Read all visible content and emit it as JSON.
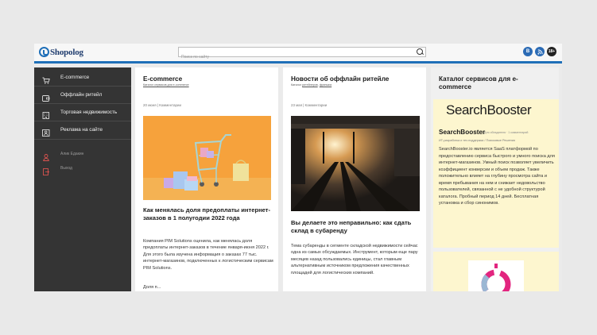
{
  "header": {
    "logo_text": "Shopolog",
    "search_placeholder": "Поиск по сайту",
    "social": [
      "В",
      "ℜ",
      "18+"
    ]
  },
  "sidebar": {
    "items": [
      {
        "label": "E-commerce",
        "icon": "cart-icon"
      },
      {
        "label": "Оффлайн ритейл",
        "icon": "wallet-icon"
      },
      {
        "label": "Торговая недвижимость",
        "icon": "building-icon"
      },
      {
        "label": "Реклама на сайте",
        "icon": "person-card-icon"
      }
    ],
    "user": {
      "name": "Алик Едакин",
      "logout": "Выход"
    }
  },
  "columns": [
    {
      "title": "E-commerce",
      "subtitle": "Каталог сервисов для e-commerce",
      "date": "20 июня",
      "comments": "Комментарии",
      "post_title": "Как менялась доля предоплаты интернет-заказов в 1 полугодии 2022 года",
      "post_text": "Компания PIM Solutions оценила, как менялась доля предоплаты интернет-заказов в течение января-июня 2022 г. Для этого была изучена информация о заказах 77 тыс. интернет-магазинов, подключенных к логистическим сервисам PIM Solutions.",
      "post_more": "Доля п..."
    },
    {
      "title": "Новости об оффлайн ритейле",
      "subtitle_prefix": "Каталог",
      "subtitle_links": [
        "ритейлеров",
        "франшиз"
      ],
      "date": "23 мая",
      "comments": "Комментарии",
      "post_title": "Вы делаете это неправильно: как сдать склад в субаренду",
      "post_text": "Тема субаренды в сегменте складской недвижимости сейчас одна из самых обсуждаемых. Инструмент, которым еще пару месяцев назад пользовались единицы, стал главным альтернативным источником предложения качественных площадей для логистических компаний."
    },
    {
      "title": "Каталог сервисов для e-commerce",
      "featured": {
        "logo": "SearchBooster",
        "name": "SearchBooster",
        "tags": "Для обладателя · 1 комментарий",
        "category": "ИТ-разработка и тех.поддержка / Поисковые Решения",
        "description": "SearchBooster.io является SaaS платформой по предоставлению сервиса быстрого и умного поиска для интернет-магазинов. Умный поиск позволяет увеличить коэффициент конверсии и объем продаж. Также положительно влияет на глубину просмотра сайта и время пребывания на нем и снижает недовольство пользователей, связанной с не удобной структурой каталога. Пробный период 14 дней. Бесплатная установка и сбор синонимов."
      }
    }
  ],
  "colors": {
    "accent": "#1f6fb8",
    "sidebar_bg": "#343434",
    "card_highlight": "#fdf6cf"
  }
}
